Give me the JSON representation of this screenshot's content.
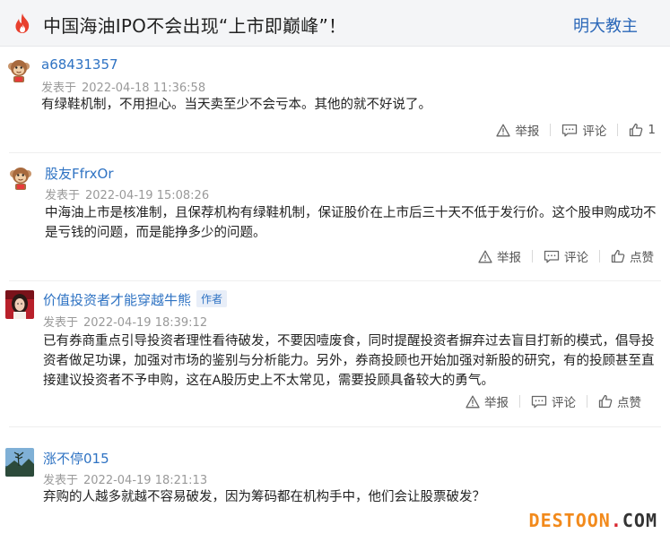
{
  "header": {
    "title": "中国海油IPO不会出现“上市即巅峰”！",
    "author": "明大教主",
    "icon": "fire-icon",
    "accent_color": "#e8402e"
  },
  "comments": [
    {
      "username": "a68431357",
      "time_prefix": "发表于",
      "time": "2022-04-18 11:36:58",
      "content": "有绿鞋机制，不用担心。当天卖至少不会亏本。其他的就不好说了。",
      "actions": {
        "report": "举报",
        "comment": "评论",
        "like": "1"
      }
    },
    {
      "username": "股友FfrxOr",
      "time_prefix": "发表于",
      "time": "2022-04-19 15:08:26",
      "content": "中海油上市是核准制，且保荐机构有绿鞋机制，保证股价在上市后三十天不低于发行价。这个股申购成功不是亏钱的问题，而是能挣多少的问题。",
      "actions": {
        "report": "举报",
        "comment": "评论",
        "like": "点赞"
      }
    },
    {
      "username": "价值投资者才能穿越牛熊",
      "badge": "作者",
      "time_prefix": "发表于",
      "time": "2022-04-19 18:39:12",
      "content": "已有券商重点引导投资者理性看待破发，不要因噎废食，同时提醒投资者摒弃过去盲目打新的模式，倡导投资者做足功课，加强对市场的鉴别与分析能力。另外，券商投顾也开始加强对新股的研究，有的投顾甚至直接建议投资者不予申购，这在A股历史上不太常见，需要投顾具备较大的勇气。",
      "actions": {
        "report": "举报",
        "comment": "评论",
        "like": "点赞"
      }
    },
    {
      "username": "涨不停015",
      "time_prefix": "发表于",
      "time": "2022-04-19 18:21:13",
      "content": "弃购的人越多就越不容易破发，因为筹码都在机构手中，他们会让股票破发？"
    }
  ],
  "watermark": {
    "part1": "DESTOON",
    "dot": ".",
    "part2": "COM"
  }
}
